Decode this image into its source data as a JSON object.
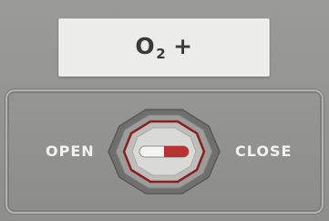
{
  "plate": {
    "label_main": "O",
    "label_sub": "2",
    "label_suffix": "+"
  },
  "valve": {
    "open_label": "OPEN",
    "close_label": "CLOSE",
    "state": "close",
    "indicator_color": "#b83232",
    "ring_color": "#8a1f1f"
  }
}
